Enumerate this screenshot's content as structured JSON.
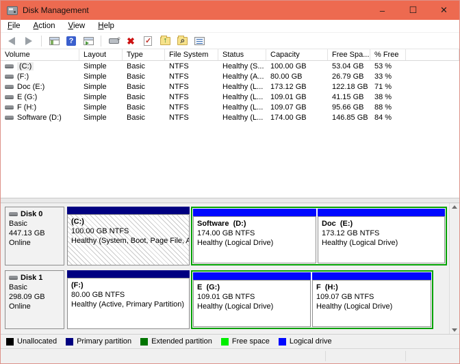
{
  "window": {
    "title": "Disk Management",
    "controls": {
      "minimize": "–",
      "maximize": "☐",
      "close": "✕"
    }
  },
  "menu": {
    "items": [
      "File",
      "Action",
      "View",
      "Help"
    ]
  },
  "toolbar": {
    "icons": [
      "back-arrow-icon",
      "forward-arrow-icon",
      "show-console-tree-icon",
      "help-icon",
      "show-action-pane-icon",
      "disk-tool-icon",
      "delete-volume-icon",
      "check-document-icon",
      "folder-up-icon",
      "folder-search-icon",
      "properties-list-icon"
    ]
  },
  "volume_table": {
    "columns": {
      "volume": "Volume",
      "layout": "Layout",
      "type": "Type",
      "fs": "File System",
      "status": "Status",
      "capacity": "Capacity",
      "free": "Free Spa...",
      "pct": "% Free"
    },
    "rows": [
      {
        "volume": "(C:)",
        "layout": "Simple",
        "type": "Basic",
        "fs": "NTFS",
        "status": "Healthy (S...",
        "capacity": "100.00 GB",
        "free": "53.04 GB",
        "pct": "53 %"
      },
      {
        "volume": "(F:)",
        "layout": "Simple",
        "type": "Basic",
        "fs": "NTFS",
        "status": "Healthy (A...",
        "capacity": "80.00 GB",
        "free": "26.79 GB",
        "pct": "33 %"
      },
      {
        "volume": "Doc (E:)",
        "layout": "Simple",
        "type": "Basic",
        "fs": "NTFS",
        "status": "Healthy (L...",
        "capacity": "173.12 GB",
        "free": "122.18 GB",
        "pct": "71 %"
      },
      {
        "volume": "E (G:)",
        "layout": "Simple",
        "type": "Basic",
        "fs": "NTFS",
        "status": "Healthy (L...",
        "capacity": "109.01 GB",
        "free": "41.15 GB",
        "pct": "38 %"
      },
      {
        "volume": "F (H:)",
        "layout": "Simple",
        "type": "Basic",
        "fs": "NTFS",
        "status": "Healthy (L...",
        "capacity": "109.07 GB",
        "free": "95.66 GB",
        "pct": "88 %"
      },
      {
        "volume": "Software (D:)",
        "layout": "Simple",
        "type": "Basic",
        "fs": "NTFS",
        "status": "Healthy (L...",
        "capacity": "174.00 GB",
        "free": "146.85 GB",
        "pct": "84 %"
      }
    ]
  },
  "disks": [
    {
      "name": "Disk 0",
      "kind": "Basic",
      "size": "447.13 GB",
      "state": "Online",
      "partitions": [
        {
          "label": "(C:)",
          "size": "100.00 GB NTFS",
          "status": "Healthy (System, Boot, Page File, A"
        },
        {
          "label": "Software  (D:)",
          "size": "174.00 GB NTFS",
          "status": "Healthy (Logical Drive)"
        },
        {
          "label": "Doc  (E:)",
          "size": "173.12 GB NTFS",
          "status": "Healthy (Logical Drive)"
        }
      ]
    },
    {
      "name": "Disk 1",
      "kind": "Basic",
      "size": "298.09 GB",
      "state": "Online",
      "partitions": [
        {
          "label": "(F:)",
          "size": "80.00 GB NTFS",
          "status": "Healthy (Active, Primary Partition)"
        },
        {
          "label": "E  (G:)",
          "size": "109.01 GB NTFS",
          "status": "Healthy (Logical Drive)"
        },
        {
          "label": "F  (H:)",
          "size": "109.07 GB NTFS",
          "status": "Healthy (Logical Drive)"
        }
      ]
    }
  ],
  "legend": {
    "items": [
      {
        "label": "Unallocated",
        "color": "#000000"
      },
      {
        "label": "Primary partition",
        "color": "#000080"
      },
      {
        "label": "Extended partition",
        "color": "#007500"
      },
      {
        "label": "Free space",
        "color": "#00ee00"
      },
      {
        "label": "Logical drive",
        "color": "#0008ff"
      }
    ]
  },
  "colors": {
    "titlebar": "#ed6a50",
    "primary_bar": "#000080",
    "logical_bar": "#0008ff",
    "extended_border": "#00a000"
  }
}
